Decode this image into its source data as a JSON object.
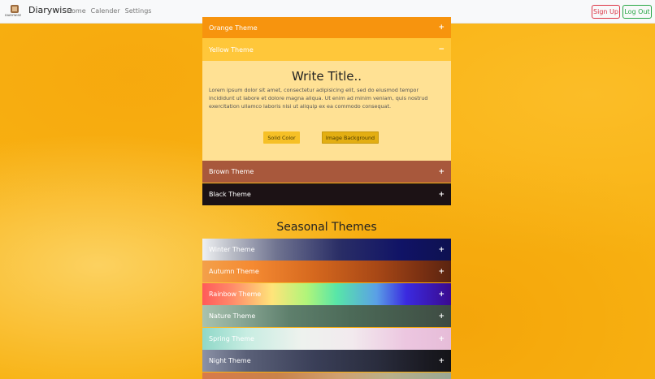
{
  "navbar": {
    "logo_text": "DIARYWISE",
    "brand": "Diarywise",
    "links": [
      "Home",
      "Calender",
      "Settings"
    ],
    "signup_label": "Sign Up",
    "logout_label": "Log Out"
  },
  "basic_themes": [
    {
      "label": "Orange Theme",
      "toggle": "+"
    },
    {
      "label": "Yellow Theme",
      "toggle": "−"
    },
    {
      "label": "Brown Theme",
      "toggle": "+"
    },
    {
      "label": "Black Theme",
      "toggle": "+"
    }
  ],
  "yellow_panel": {
    "title": "Write Title..",
    "body": "Lorem ipsum dolor sit amet, consectetur adipisicing elit, sed do eiusmod tempor incididunt ut labore et dolore magna aliqua. Ut enim ad minim veniam, quis nostrud exercitation ullamco laboris nisi ut aliquip ex ea commodo consequat.",
    "solid_label": "Solid Color",
    "image_label": "Image Background"
  },
  "seasonal_heading": "Seasonal Themes",
  "seasonal_themes": [
    {
      "label": "Winter Theme",
      "toggle": "+"
    },
    {
      "label": "Autumn Theme",
      "toggle": "+"
    },
    {
      "label": "Rainbow Theme",
      "toggle": "+"
    },
    {
      "label": "Nature Theme",
      "toggle": "+"
    },
    {
      "label": "Spring Theme",
      "toggle": "+"
    },
    {
      "label": "Night Theme",
      "toggle": "+"
    }
  ],
  "colors": {
    "orange": "#f7940e",
    "yellow": "#ffc73a",
    "brown": "#a8583c",
    "black": "#1c1215",
    "signup": "#dc3545",
    "logout": "#28a745"
  }
}
